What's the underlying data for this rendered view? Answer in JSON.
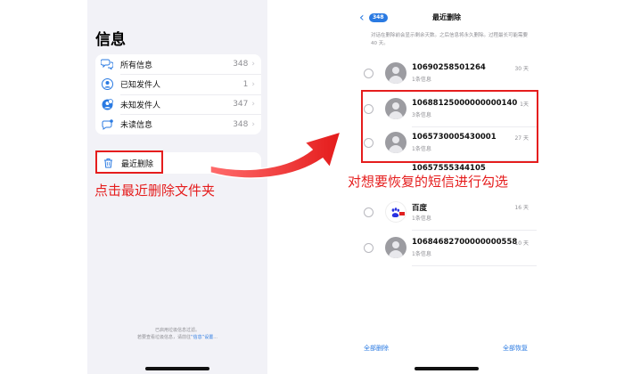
{
  "left_screen": {
    "title": "信息",
    "filters": [
      {
        "label": "所有信息",
        "count": "348",
        "icon": "message-bubbles-icon"
      },
      {
        "label": "已知发件人",
        "count": "1",
        "icon": "known-contact-icon"
      },
      {
        "label": "未知发件人",
        "count": "347",
        "icon": "unknown-contact-icon"
      },
      {
        "label": "未读信息",
        "count": "348",
        "icon": "unread-bubble-icon"
      }
    ],
    "chevron": "›",
    "recently_deleted": {
      "label": "最近删除",
      "icon": "trash-icon"
    },
    "annotation": "点击最近删除文件夹",
    "footnote_line1": "已启用垃圾信息过滤。",
    "footnote_line2_prefix": "若要查看垃圾信息，请前往",
    "footnote_link": "“信息”设置",
    "footnote_suffix": "..."
  },
  "right_screen": {
    "back_count": "348",
    "title": "最近删除",
    "notice": "对话在删除前会显示剩余天数。之后信息将永久删除。过程最长可能需要 40 天。",
    "messages": [
      {
        "name": "10690258501264",
        "subtitle": "1条信息",
        "days": "30 天"
      },
      {
        "name": "10688125000000000140",
        "subtitle": "3条信息",
        "days": "1天"
      },
      {
        "name": "1065730005430001",
        "subtitle": "1条信息",
        "days": "27 天"
      },
      {
        "name": "10657555344105",
        "subtitle": "",
        "days": ""
      },
      {
        "name": "百度",
        "subtitle": "1条信息",
        "days": "16 天"
      },
      {
        "name": "10684682700000000558",
        "subtitle": "1条信息",
        "days": "10 天"
      }
    ],
    "annotation": "对想要恢复的短信进行勾选",
    "delete_all": "全部删除",
    "recover_all": "全部恢复"
  },
  "colors": {
    "annotation_red": "#e51d1d",
    "ios_blue": "#2a7ae2",
    "ios_gray_bg": "#f2f2f7",
    "secondary_text": "#8e8e93"
  }
}
